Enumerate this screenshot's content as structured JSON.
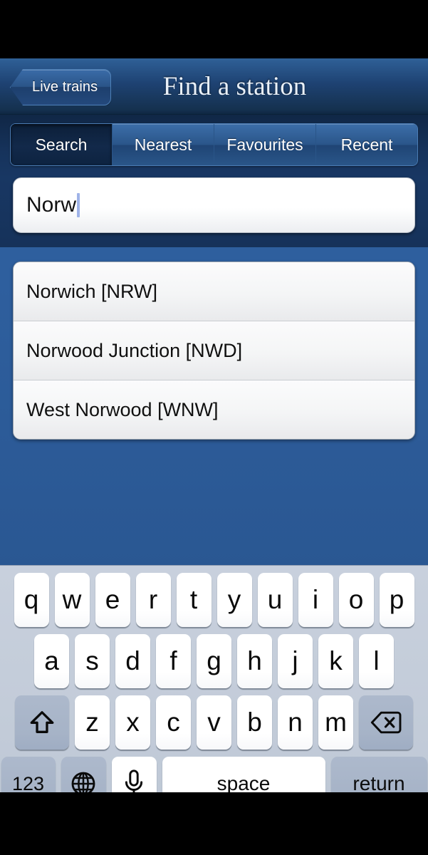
{
  "window": {
    "letterbox_color": "#000000",
    "app_background": "#2e5f9e"
  },
  "navbar": {
    "back_label": "Live trains",
    "title": "Find a station"
  },
  "tabs": [
    {
      "label": "Search",
      "selected": true
    },
    {
      "label": "Nearest",
      "selected": false
    },
    {
      "label": "Favourites",
      "selected": false
    },
    {
      "label": "Recent",
      "selected": false
    }
  ],
  "search": {
    "value": "Norw",
    "placeholder": "",
    "caret_color": "#9fb3e8"
  },
  "results": [
    {
      "label": "Norwich [NRW]"
    },
    {
      "label": "Norwood Junction [NWD]"
    },
    {
      "label": "West Norwood [WNW]"
    }
  ],
  "keyboard": {
    "row1": [
      "q",
      "w",
      "e",
      "r",
      "t",
      "y",
      "u",
      "i",
      "o",
      "p"
    ],
    "row2": [
      "a",
      "s",
      "d",
      "f",
      "g",
      "h",
      "j",
      "k",
      "l"
    ],
    "row3_letters": [
      "z",
      "x",
      "c",
      "v",
      "b",
      "n",
      "m"
    ],
    "shift_icon": "shift-arrow-icon",
    "backspace_icon": "backspace-icon",
    "numbers_label": "123",
    "globe_icon": "globe-icon",
    "mic_icon": "microphone-icon",
    "space_label": "space",
    "return_label": "return"
  }
}
